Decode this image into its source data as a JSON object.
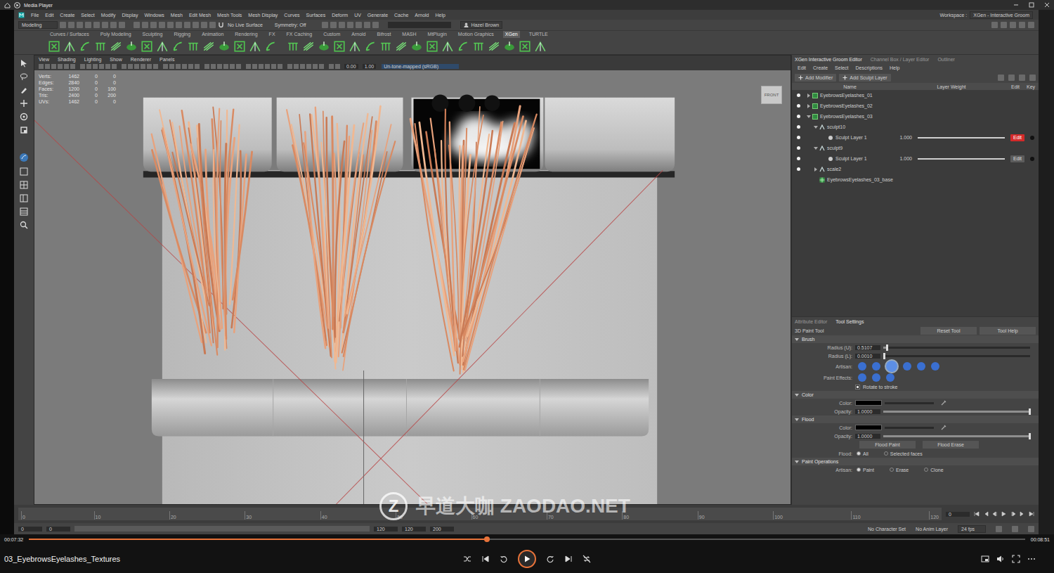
{
  "player": {
    "title": "Media Player",
    "video_title": "03_EyebrowsEyelashes_Textures",
    "elapsed": "00:07:32",
    "duration": "00:08:51",
    "progress": 0.46,
    "playing": false,
    "watermark_logo": "Z",
    "watermark": "早道大咖 ZAODAO.NET"
  },
  "maya": {
    "menus": [
      "File",
      "Edit",
      "Create",
      "Select",
      "Modify",
      "Display",
      "Windows",
      "Mesh",
      "Edit Mesh",
      "Mesh Tools",
      "Mesh Display",
      "Curves",
      "Surfaces",
      "Deform",
      "UV",
      "Generate",
      "Cache",
      "Arnold",
      "Help"
    ],
    "workspace_label": "Workspace :",
    "workspace": "XGen - Interactive Groom",
    "mode": "Modeling",
    "live_surface": "No Live Surface",
    "symmetry": "Symmetry: Off",
    "user": "Hazel Brown",
    "shelf_tabs": [
      {
        "label": "Curves / Surfaces",
        "selected": false
      },
      {
        "label": "Poly Modeling",
        "selected": false
      },
      {
        "label": "Sculpting",
        "selected": false
      },
      {
        "label": "Rigging",
        "selected": false
      },
      {
        "label": "Animation",
        "selected": false
      },
      {
        "label": "Rendering",
        "selected": false
      },
      {
        "label": "FX",
        "selected": false
      },
      {
        "label": "FX Caching",
        "selected": false
      },
      {
        "label": "Custom",
        "selected": false
      },
      {
        "label": "Arnold",
        "selected": false
      },
      {
        "label": "Bifrost",
        "selected": false
      },
      {
        "label": "MASH",
        "selected": false
      },
      {
        "label": "MtPlugin",
        "selected": false
      },
      {
        "label": "Motion Graphics",
        "selected": false
      },
      {
        "label": "XGen",
        "selected": true
      },
      {
        "label": "TURTLE",
        "selected": false
      }
    ],
    "viewport": {
      "menus": [
        "View",
        "Shading",
        "Lighting",
        "Show",
        "Renderer",
        "Panels"
      ],
      "fields": [
        "0.00",
        "1.00"
      ],
      "colorspace": "Un-tone-mapped (sRGB)",
      "hud": [
        {
          "label": "Verts:",
          "values": [
            "1462",
            "0",
            "0"
          ]
        },
        {
          "label": "Edges:",
          "values": [
            "2840",
            "0",
            "0"
          ]
        },
        {
          "label": "Faces:",
          "values": [
            "1200",
            "0",
            "100"
          ]
        },
        {
          "label": "Tris:",
          "values": [
            "2400",
            "0",
            "200"
          ]
        },
        {
          "label": "UVs:",
          "values": [
            "1462",
            "0",
            "0"
          ]
        }
      ],
      "cube": "FRONT"
    },
    "editor": {
      "tabs": [
        {
          "label": "XGen Interactive Groom Editor",
          "selected": true
        },
        {
          "label": "Channel Box / Layer Editor",
          "selected": false
        },
        {
          "label": "Outliner",
          "selected": false
        }
      ],
      "menus": [
        "Edit",
        "Create",
        "Select",
        "Descriptions",
        "Help"
      ],
      "buttons": [
        "Add Modifier",
        "Add Sculpt Layer"
      ],
      "columns": [
        "Name",
        "Layer Weight",
        "Edit",
        "Key"
      ],
      "rows": [
        {
          "name": "EyebrowsEyelashes_01",
          "kind": "description",
          "visible": true,
          "expanded": false
        },
        {
          "name": "EyebrowsEyelashes_02",
          "kind": "description",
          "visible": true,
          "expanded": false
        },
        {
          "name": "EyebrowsEyelashes_03",
          "kind": "description",
          "visible": true,
          "expanded": true
        },
        {
          "name": "sculpt10",
          "kind": "modifier",
          "visible": true,
          "expanded": true
        },
        {
          "name": "Sculpt Layer 1",
          "kind": "layer",
          "visible": true,
          "weight": "1.000",
          "level": 1,
          "edit": "Edit",
          "edit_active": true
        },
        {
          "name": "sculpt9",
          "kind": "modifier",
          "visible": true,
          "expanded": true
        },
        {
          "name": "Sculpt Layer 1",
          "kind": "layer",
          "visible": true,
          "weight": "1.000",
          "level": 1,
          "edit": "Edit",
          "edit_active": false
        },
        {
          "name": "scale2",
          "kind": "modifier",
          "visible": true,
          "expanded": false
        },
        {
          "name": "EyebrowsEyelashes_03_base",
          "kind": "base",
          "visible": false
        }
      ]
    },
    "tool_settings": {
      "tabs": [
        {
          "label": "Attribute Editor",
          "selected": false
        },
        {
          "label": "Tool Settings",
          "selected": true
        }
      ],
      "tool": "3D Paint Tool",
      "buttons": [
        "Reset Tool",
        "Tool Help"
      ],
      "sections": [
        {
          "title": "Brush",
          "rows": [
            {
              "kind": "slider",
              "label": "Radius (U):",
              "value": "0.5107",
              "level": 0.03
            },
            {
              "kind": "slider",
              "label": "Radius (L):",
              "value": "0.0010",
              "level": 0.01
            },
            {
              "kind": "icons",
              "label": "Artisan:",
              "options": [
                {
                  "selected": false
                },
                {
                  "selected": false
                },
                {
                  "selected": true
                },
                {
                  "selected": false
                },
                {
                  "selected": false
                },
                {
                  "selected": false
                }
              ]
            },
            {
              "kind": "icons",
              "label": "Paint Effects:",
              "options": [
                {
                  "selected": false
                },
                {
                  "selected": false
                },
                {
                  "selected": false
                }
              ]
            },
            {
              "kind": "checkbox",
              "label": "Rotate to stroke",
              "checked": true
            }
          ]
        },
        {
          "title": "Color",
          "rows": [
            {
              "kind": "swatch",
              "label": "Color:",
              "color": "#000000"
            },
            {
              "kind": "slider",
              "label": "Opacity:",
              "value": "1.0000",
              "level": 1
            }
          ]
        },
        {
          "title": "Flood",
          "rows": [
            {
              "kind": "swatch",
              "label": "Color:",
              "color": "#000000"
            },
            {
              "kind": "slider",
              "label": "Opacity:",
              "value": "1.0000",
              "level": 1
            },
            {
              "kind": "buttons",
              "labels": [
                "Flood Paint",
                "Flood Erase"
              ]
            },
            {
              "kind": "radios",
              "label": "Flood:",
              "options": [
                {
                  "label": "All",
                  "selected": true
                },
                {
                  "label": "Selected faces",
                  "selected": false
                }
              ]
            }
          ]
        },
        {
          "title": "Paint Operations",
          "rows": [
            {
              "kind": "radios",
              "label": "Artisan:",
              "options": [
                {
                  "label": "Paint",
                  "selected": true
                },
                {
                  "label": "Erase",
                  "selected": false
                },
                {
                  "label": "Clone",
                  "selected": false
                }
              ]
            }
          ]
        }
      ]
    },
    "timeline": {
      "current": "0",
      "ticks": [
        "0",
        "10",
        "20",
        "30",
        "40",
        "50",
        "60",
        "70",
        "80",
        "90",
        "100",
        "110",
        "120"
      ],
      "range": [
        "0",
        "0",
        "120",
        "120",
        "200"
      ],
      "character_set": "No Character Set",
      "anim_layer": "No Anim Layer",
      "fps": "24 fps"
    }
  }
}
